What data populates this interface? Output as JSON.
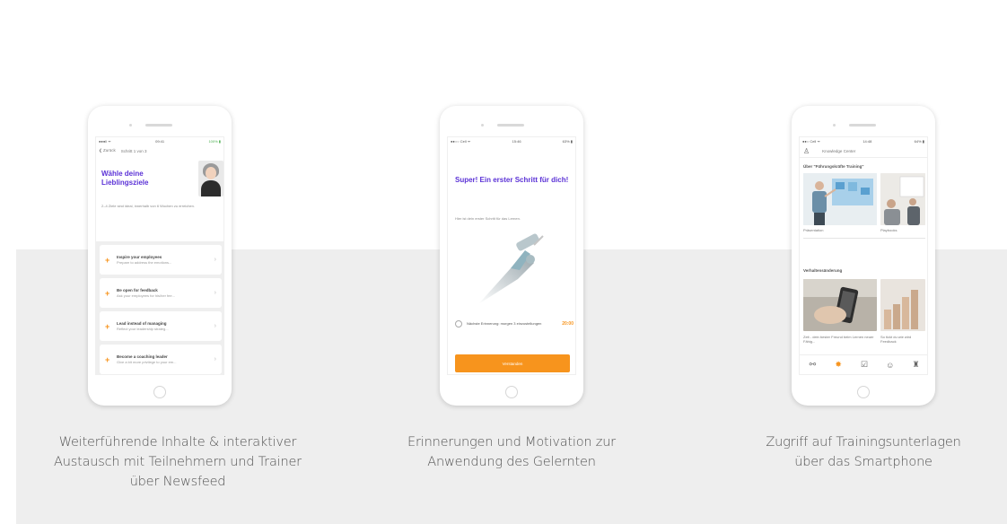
{
  "phones": [
    {
      "status": {
        "left": "●●●ll ᯤ",
        "center": "09:41",
        "right": "100% ▮"
      },
      "nav": {
        "back": "❮ Zurück",
        "title": "Schritt 1 von 3"
      },
      "title": "Wähle deine Lieblingsziele",
      "subtitle": "2–4 Ziele sind ideal, innerhalb von 6 Wochen zu erreichen.",
      "items": [
        {
          "title": "Inspire your employees",
          "desc": "Prepare to address the emotions..."
        },
        {
          "title": "Be open for feedback",
          "desc": "Ask your employees for his/her fee..."
        },
        {
          "title": "Lead instead of managing",
          "desc": "Reflect your leadership strateg..."
        },
        {
          "title": "Become a coaching leader",
          "desc": "Give a bit more privilege to your em..."
        }
      ],
      "caption_lines": [
        "Weiterführende Inhalte & interaktiver",
        "Austausch mit Teilnehmern und Trainer",
        "über Newsfeed"
      ]
    },
    {
      "status": {
        "left": "●●○○ Cell ᯤ",
        "center": "15:46",
        "right": "63% ▮"
      },
      "title": "Super! Ein erster Schritt für dich!",
      "subtitle": "Hier ist dein erster Schritt für das Lernen.",
      "reminder_text": "Nächste Erinnerung: morgen 3 einzustellungen",
      "reminder_time": "20:00",
      "button_label": "Verstanden",
      "caption_lines": [
        "Erinnerungen und Motivation zur",
        "Anwendung des Gelernten"
      ]
    },
    {
      "status": {
        "left": "●●○ Cell ᯤ",
        "center": "14:48",
        "right": "64% ▮"
      },
      "header_title": "Knowledge Center",
      "section1": "Über \"Führungskräfte Training\"",
      "tile1_label": "Präsentation",
      "tile2_label": "Playbooks",
      "section2": "Verhaltensänderung",
      "tile3_label": "Zeit - dein bester Freund beim Lernen neuer Fähig...",
      "tile4_label": "So tickt du wie wird Feedback",
      "caption_lines": [
        "Zugriff auf Trainingsunterlagen",
        "über das Smartphone"
      ]
    }
  ],
  "colors": {
    "accent": "#f7941d",
    "title": "#5b32d6",
    "band": "#eeeeee"
  }
}
